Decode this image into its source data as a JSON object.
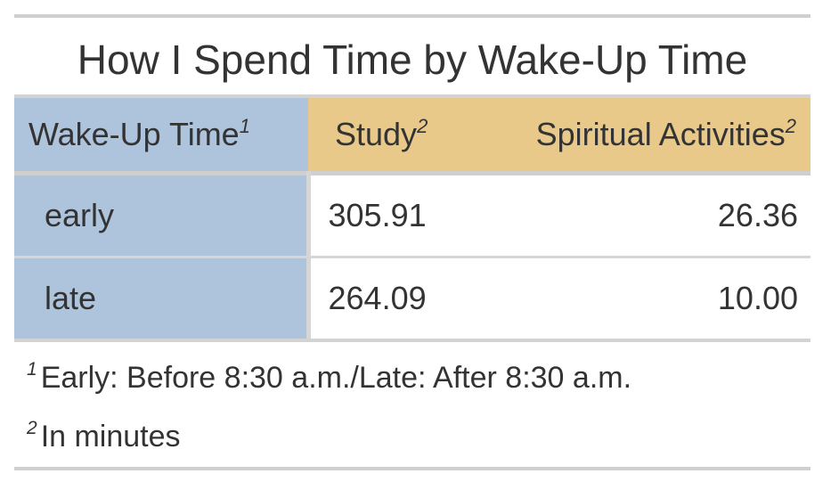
{
  "chart_data": {
    "type": "table",
    "title": "How I Spend Time by Wake-Up Time",
    "columns": [
      {
        "label": "Wake-Up Time",
        "footnote_mark": "1"
      },
      {
        "label": "Study",
        "footnote_mark": "2"
      },
      {
        "label": "Spiritual Activities",
        "footnote_mark": "2"
      }
    ],
    "rows": [
      {
        "wake_up_time": "early",
        "study": "305.91",
        "spiritual_activities": "26.36"
      },
      {
        "wake_up_time": "late",
        "study": "264.09",
        "spiritual_activities": "10.00"
      }
    ],
    "footnotes": [
      {
        "mark": "1",
        "text": "Early: Before 8:30 a.m./Late: After 8:30 a.m."
      },
      {
        "mark": "2",
        "text": "In minutes"
      }
    ]
  },
  "colors": {
    "stub_background": "#aec4dc",
    "column_header_background": "#e8c98a",
    "rule": "#cfcfcf",
    "text": "#333333"
  }
}
